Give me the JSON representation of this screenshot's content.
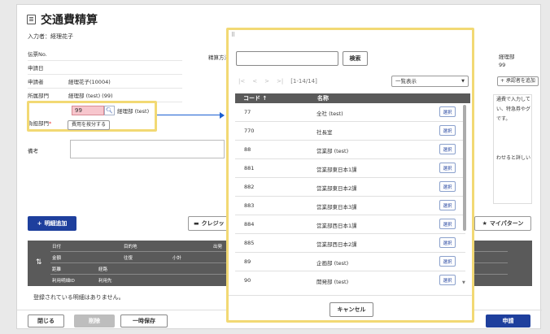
{
  "page": {
    "title": "交通費精算",
    "inputter": "入力者：経理花子"
  },
  "form": {
    "voucher_no_label": "伝票No.",
    "calc_method_label": "精算方法",
    "apply_date_label": "申請日",
    "applicant_label": "申請者",
    "applicant_value": "経理花子(10004)",
    "dept_label": "所属部門",
    "dept_value": "経理部 (test) (99)",
    "charge_dept_label": "負担部門",
    "required_mark": "*",
    "charge_code": "99",
    "charge_name": "経理部 (test)",
    "split_cost_label": "費用を按分する",
    "remarks_label": "備考"
  },
  "right_panel": {
    "dept_line1": "経理部",
    "dept_line2": "99",
    "add_approver_label": "+ 承認者を追加",
    "notice_lines": [
      "通費で入力して",
      "い、特急券やグ",
      "です。",
      "",
      "",
      "",
      "わせると詳しい"
    ]
  },
  "actions": {
    "add_detail_label": "明細追加",
    "credit_label": "クレジッ",
    "my_pattern_label": "マイパターン"
  },
  "detail_table": {
    "row1": [
      "日付",
      "目的地",
      "出発"
    ],
    "row2": [
      "金額",
      "往復",
      "小計"
    ],
    "row3": [
      "距離",
      "経路"
    ],
    "row4": [
      "利用明細ID",
      "利用先"
    ]
  },
  "empty_message": "登録されている明細はありません。",
  "footer": {
    "close_label": "閉じる",
    "delete_label": "削除",
    "temp_save_label": "一時保存",
    "apply_label": "申請"
  },
  "modal": {
    "drag_handle": "⠿",
    "search_button": "検索",
    "pager_range": "[1-14/14]",
    "view_mode": "一覧表示",
    "col_code": "コード ↑",
    "col_name": "名称",
    "select_label": "選択",
    "rows": [
      {
        "code": "77",
        "name": "全社 (test)"
      },
      {
        "code": "770",
        "name": "社長室"
      },
      {
        "code": "88",
        "name": "営業部 (test)"
      },
      {
        "code": "881",
        "name": "営業部東日本1課"
      },
      {
        "code": "882",
        "name": "営業部東日本2課"
      },
      {
        "code": "883",
        "name": "営業部東日本3課"
      },
      {
        "code": "884",
        "name": "営業部西日本1課"
      },
      {
        "code": "885",
        "name": "営業部西日本2課"
      },
      {
        "code": "89",
        "name": "企画部 (test)"
      },
      {
        "code": "90",
        "name": "開発部 (test)"
      }
    ],
    "cancel_label": "キャンセル"
  },
  "colors": {
    "accent": "#1e3f9d",
    "highlight": "#f2d974",
    "error_field": "#f7c6cd",
    "arrow": "#1a5fd1"
  }
}
